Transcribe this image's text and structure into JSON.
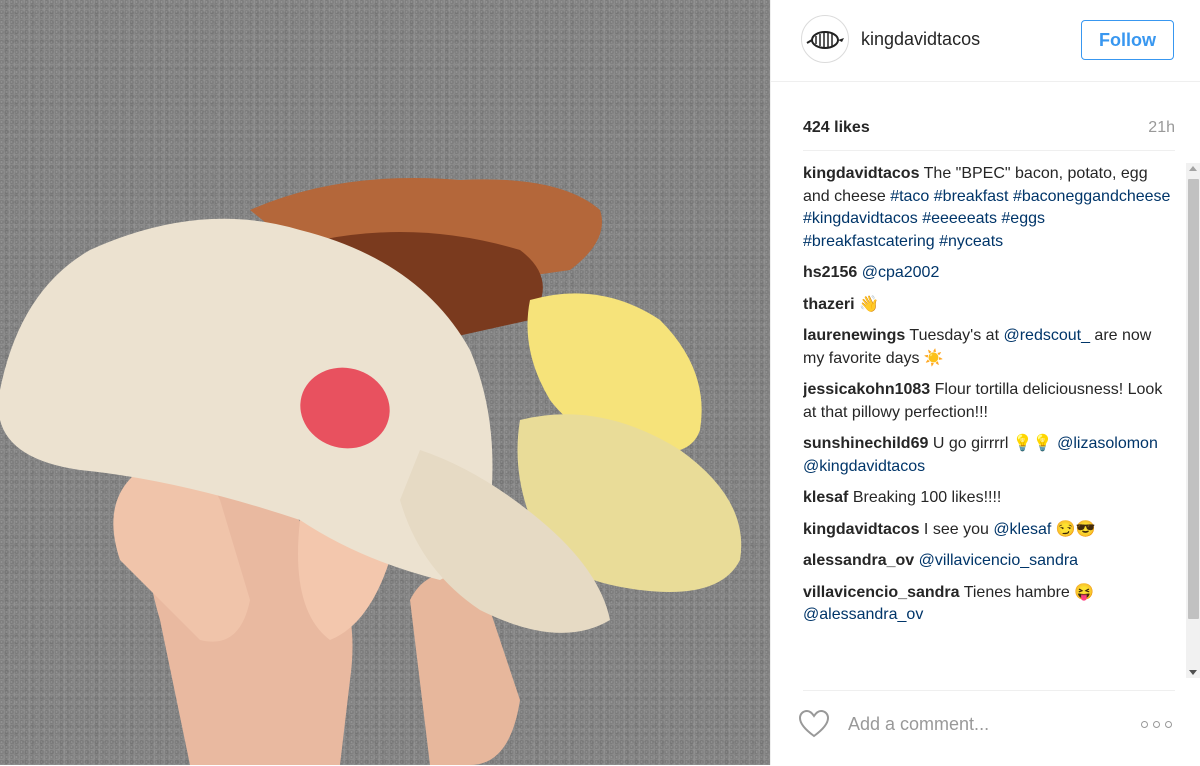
{
  "post": {
    "username": "kingdavidtacos",
    "follow_label": "Follow",
    "likes": "424 likes",
    "time": "21h",
    "image_alt": "Hand holding a breakfast taco with bacon, potato, egg and cheese",
    "avatar_icon": "armadillo-logo-icon"
  },
  "comments": [
    {
      "user": "kingdavidtacos",
      "parts": [
        {
          "t": " The \"BPEC\" bacon, potato, egg and cheese "
        },
        {
          "t": "#taco",
          "link": true
        },
        {
          "t": " "
        },
        {
          "t": "#breakfast",
          "link": true
        },
        {
          "t": " "
        },
        {
          "t": "#baconeggandcheese",
          "link": true
        },
        {
          "t": " "
        },
        {
          "t": "#kingdavidtacos",
          "link": true
        },
        {
          "t": " "
        },
        {
          "t": "#eeeeeats",
          "link": true
        },
        {
          "t": " "
        },
        {
          "t": "#eggs",
          "link": true
        },
        {
          "t": " "
        },
        {
          "t": "#breakfastcatering",
          "link": true
        },
        {
          "t": " "
        },
        {
          "t": "#nyceats",
          "link": true
        }
      ]
    },
    {
      "user": "hs2156",
      "parts": [
        {
          "t": " "
        },
        {
          "t": "@cpa2002",
          "link": true
        }
      ]
    },
    {
      "user": "thazeri",
      "parts": [
        {
          "t": " 👋"
        }
      ]
    },
    {
      "user": "laurenewings",
      "parts": [
        {
          "t": " Tuesday's at "
        },
        {
          "t": "@redscout_",
          "link": true
        },
        {
          "t": " are now my favorite days ☀️"
        }
      ]
    },
    {
      "user": "jessicakohn1083",
      "parts": [
        {
          "t": " Flour tortilla deliciousness! Look at that pillowy perfection!!!"
        }
      ]
    },
    {
      "user": "sunshinechild69",
      "parts": [
        {
          "t": " U go girrrrl 💡💡 "
        },
        {
          "t": "@lizasolomon",
          "link": true
        },
        {
          "t": " "
        },
        {
          "t": "@kingdavidtacos",
          "link": true
        }
      ]
    },
    {
      "user": "klesaf",
      "parts": [
        {
          "t": " Breaking 100 likes!!!!"
        }
      ]
    },
    {
      "user": "kingdavidtacos",
      "parts": [
        {
          "t": " I see you "
        },
        {
          "t": "@klesaf",
          "link": true
        },
        {
          "t": " 😏😎"
        }
      ]
    },
    {
      "user": "alessandra_ov",
      "parts": [
        {
          "t": " "
        },
        {
          "t": "@villavicencio_sandra",
          "link": true
        }
      ]
    },
    {
      "user": "villavicencio_sandra",
      "parts": [
        {
          "t": " Tienes hambre 😝 "
        },
        {
          "t": "@alessandra_ov",
          "link": true
        }
      ]
    }
  ],
  "footer": {
    "comment_placeholder": "Add a comment...",
    "like_icon": "heart-icon",
    "more_icon": "more-options-icon"
  },
  "colors": {
    "accent": "#3897f0",
    "link": "#003569",
    "muted": "#999999",
    "border": "#efefef"
  }
}
